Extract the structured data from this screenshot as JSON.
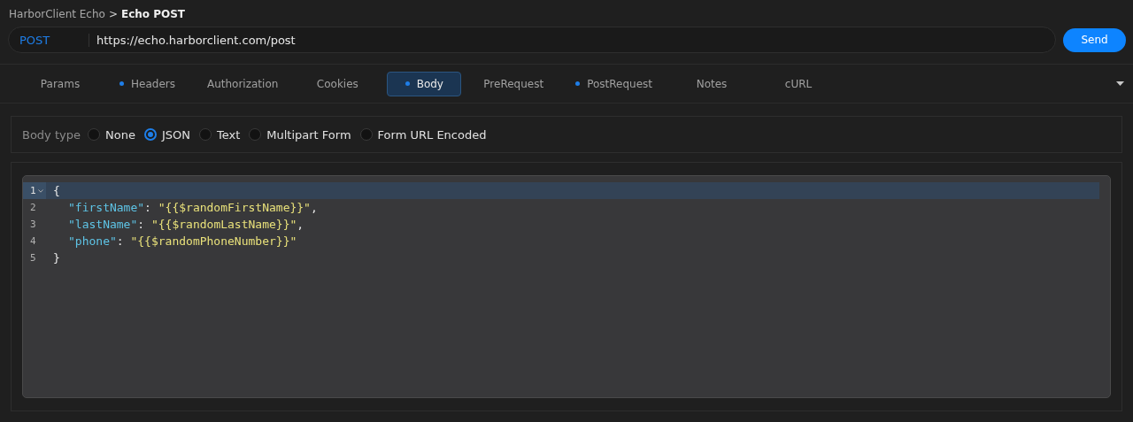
{
  "breadcrumb": {
    "parent": "HarborClient Echo",
    "separator": ">",
    "current": "Echo POST"
  },
  "request": {
    "method": "POST",
    "url": "https://echo.harborclient.com/post",
    "send": "Send"
  },
  "tabs": [
    {
      "label": "Params",
      "selected": false,
      "dot": false
    },
    {
      "label": "Headers",
      "selected": false,
      "dot": true
    },
    {
      "label": "Authorization",
      "selected": false,
      "dot": false
    },
    {
      "label": "Cookies",
      "selected": false,
      "dot": false
    },
    {
      "label": "Body",
      "selected": true,
      "dot": true
    },
    {
      "label": "PreRequest",
      "selected": false,
      "dot": false
    },
    {
      "label": "PostRequest",
      "selected": false,
      "dot": true
    },
    {
      "label": "Notes",
      "selected": false,
      "dot": false
    },
    {
      "label": "cURL",
      "selected": false,
      "dot": false
    }
  ],
  "body_type": {
    "label": "Body type",
    "options": [
      {
        "label": "None",
        "selected": false
      },
      {
        "label": "JSON",
        "selected": true
      },
      {
        "label": "Text",
        "selected": false
      },
      {
        "label": "Multipart Form",
        "selected": false
      },
      {
        "label": "Form URL Encoded",
        "selected": false
      }
    ]
  },
  "editor": {
    "lines": [
      {
        "number": "1",
        "active": true,
        "foldable": true,
        "indented": false,
        "tokens": [
          {
            "kind": "punct",
            "text": "{"
          }
        ]
      },
      {
        "number": "2",
        "active": false,
        "foldable": false,
        "indented": true,
        "tokens": [
          {
            "kind": "key",
            "text": "\"firstName\""
          },
          {
            "kind": "punct",
            "text": ": "
          },
          {
            "kind": "string",
            "text": "\"{{$randomFirstName}}\""
          },
          {
            "kind": "punct",
            "text": ","
          }
        ]
      },
      {
        "number": "3",
        "active": false,
        "foldable": false,
        "indented": true,
        "tokens": [
          {
            "kind": "key",
            "text": "\"lastName\""
          },
          {
            "kind": "punct",
            "text": ": "
          },
          {
            "kind": "string",
            "text": "\"{{$randomLastName}}\""
          },
          {
            "kind": "punct",
            "text": ","
          }
        ]
      },
      {
        "number": "4",
        "active": false,
        "foldable": false,
        "indented": true,
        "tokens": [
          {
            "kind": "key",
            "text": "\"phone\""
          },
          {
            "kind": "punct",
            "text": ": "
          },
          {
            "kind": "string",
            "text": "\"{{$randomPhoneNumber}}\""
          }
        ]
      },
      {
        "number": "5",
        "active": false,
        "foldable": false,
        "indented": false,
        "tokens": [
          {
            "kind": "punct",
            "text": "}"
          }
        ]
      }
    ]
  }
}
